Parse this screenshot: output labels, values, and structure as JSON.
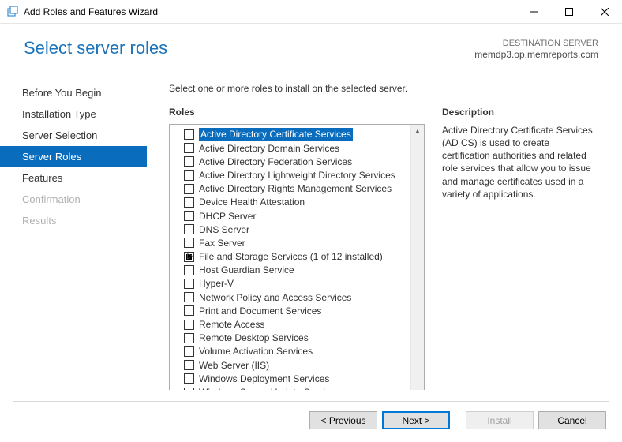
{
  "window": {
    "title": "Add Roles and Features Wizard"
  },
  "header": {
    "page_title": "Select server roles",
    "dest_label": "DESTINATION SERVER",
    "dest_server": "memdp3.op.memreports.com"
  },
  "nav": {
    "items": [
      {
        "label": "Before You Begin",
        "state": "normal"
      },
      {
        "label": "Installation Type",
        "state": "normal"
      },
      {
        "label": "Server Selection",
        "state": "normal"
      },
      {
        "label": "Server Roles",
        "state": "active"
      },
      {
        "label": "Features",
        "state": "normal"
      },
      {
        "label": "Confirmation",
        "state": "disabled"
      },
      {
        "label": "Results",
        "state": "disabled"
      }
    ]
  },
  "main": {
    "instruction": "Select one or more roles to install on the selected server.",
    "roles_header": "Roles",
    "desc_header": "Description",
    "roles": [
      {
        "label": "Active Directory Certificate Services",
        "selected": true,
        "checked": false
      },
      {
        "label": "Active Directory Domain Services",
        "checked": false
      },
      {
        "label": "Active Directory Federation Services",
        "checked": false
      },
      {
        "label": "Active Directory Lightweight Directory Services",
        "checked": false
      },
      {
        "label": "Active Directory Rights Management Services",
        "checked": false
      },
      {
        "label": "Device Health Attestation",
        "checked": false
      },
      {
        "label": "DHCP Server",
        "checked": false
      },
      {
        "label": "DNS Server",
        "checked": false
      },
      {
        "label": "Fax Server",
        "checked": false
      },
      {
        "label": "File and Storage Services (1 of 12 installed)",
        "checked": "filled",
        "expandable": true
      },
      {
        "label": "Host Guardian Service",
        "checked": false
      },
      {
        "label": "Hyper-V",
        "checked": false
      },
      {
        "label": "Network Policy and Access Services",
        "checked": false
      },
      {
        "label": "Print and Document Services",
        "checked": false
      },
      {
        "label": "Remote Access",
        "checked": false
      },
      {
        "label": "Remote Desktop Services",
        "checked": false
      },
      {
        "label": "Volume Activation Services",
        "checked": false
      },
      {
        "label": "Web Server (IIS)",
        "checked": false
      },
      {
        "label": "Windows Deployment Services",
        "checked": false
      },
      {
        "label": "Windows Server Update Services",
        "checked": false
      }
    ],
    "description": "Active Directory Certificate Services (AD CS) is used to create certification authorities and related role services that allow you to issue and manage certificates used in a variety of applications."
  },
  "footer": {
    "previous": "< Previous",
    "next": "Next >",
    "install": "Install",
    "cancel": "Cancel"
  }
}
